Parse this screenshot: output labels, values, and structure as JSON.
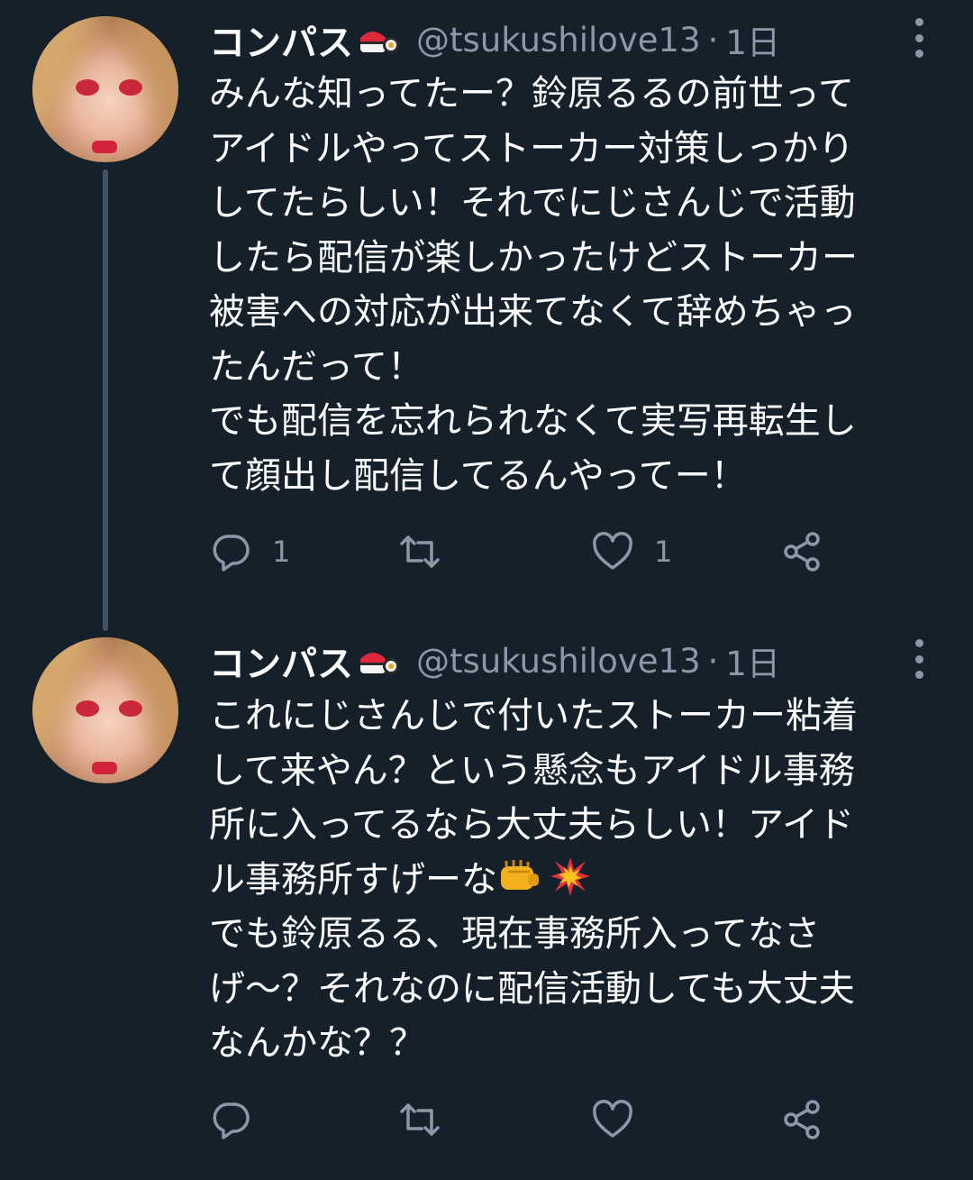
{
  "tweets": [
    {
      "name": "コンパス",
      "name_emoji": "sushi-emoji",
      "handle": "@tsukushilove13",
      "separator": "·",
      "time": "1日",
      "lines": [
        "みんな知ってたー？鈴原るるの前世って",
        "アイドルやってストーカー対策しっかり",
        "してたらしい！それでにじさんじで活動",
        "したら配信が楽しかったけどストーカー",
        "被害への対応が出来てなくて辞めちゃっ",
        "たんだって！",
        "でも配信を忘れられなくて実写再転生し",
        "て顔出し配信してるんやってー！"
      ],
      "reply_count": "1",
      "retweet_count": "",
      "like_count": "1"
    },
    {
      "name": "コンパス",
      "name_emoji": "sushi-emoji",
      "handle": "@tsukushilove13",
      "separator": "·",
      "time": "1日",
      "lines": [
        "これにじさんじで付いたストーカー粘着",
        "して来やん？という懸念もアイドル事務",
        "所に入ってるなら大丈夫らしい！アイド",
        "ル事務所すげーな",
        "でも鈴原るる、現在事務所入ってなさ",
        "げ〜？それなのに配信活動しても大丈夫",
        "なんかな？？"
      ],
      "line_emojis": [
        "oncoming-fist-emoji",
        "collision-emoji"
      ],
      "reply_count": "",
      "retweet_count": "",
      "like_count": ""
    }
  ],
  "colors": {
    "background": "#15202b",
    "text": "#ffffff",
    "secondary": "#8b98a5",
    "thread_line": "#3d5466"
  },
  "icons": [
    "reply-icon",
    "retweet-icon",
    "like-icon",
    "share-icon",
    "more-icon"
  ]
}
